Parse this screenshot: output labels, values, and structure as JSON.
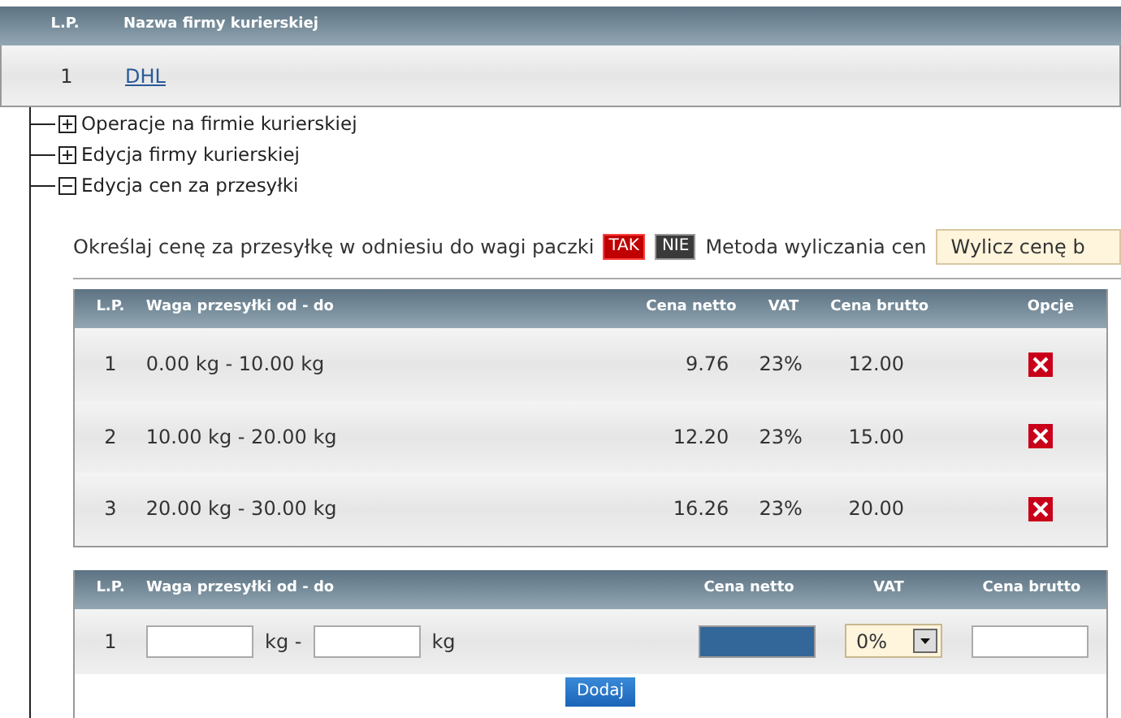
{
  "companies_table": {
    "columns": [
      "L.P.",
      "Nazwa firmy kurierskiej"
    ],
    "rows": [
      {
        "lp": "1",
        "name": "DHL"
      }
    ]
  },
  "tree": [
    {
      "label": "Operacje na firmie kurierskiej",
      "expanded": false
    },
    {
      "label": "Edycja firmy kurierskiej",
      "expanded": false
    },
    {
      "label": "Edycja cen za przesyłki",
      "expanded": true
    }
  ],
  "weight_pricing": {
    "label": "Określaj cenę za przesyłkę w odniesiu do wagi paczki",
    "options": [
      {
        "label": "TAK",
        "selected": true
      },
      {
        "label": "NIE",
        "selected": false
      }
    ],
    "method_label": "Metoda wyliczania cen",
    "method_value": "Wylicz cenę b"
  },
  "prices_table": {
    "columns": [
      "L.P.",
      "Waga przesyłki od - do",
      "Cena netto",
      "VAT",
      "Cena brutto",
      "Opcje"
    ],
    "rows": [
      {
        "lp": "1",
        "weight": "0.00 kg - 10.00 kg",
        "net": "9.76",
        "vat": "23%",
        "gross": "12.00"
      },
      {
        "lp": "2",
        "weight": "10.00 kg - 20.00 kg",
        "net": "12.20",
        "vat": "23%",
        "gross": "15.00"
      },
      {
        "lp": "3",
        "weight": "20.00 kg - 30.00 kg",
        "net": "16.26",
        "vat": "23%",
        "gross": "20.00"
      }
    ]
  },
  "add_form": {
    "columns": [
      "L.P.",
      "Waga przesyłki od - do",
      "Cena netto",
      "VAT",
      "Cena brutto"
    ],
    "lp": "1",
    "unit_from": "kg -",
    "unit_to": "kg",
    "net_highlighted": true,
    "vat": "0%",
    "button": "Dodaj"
  }
}
